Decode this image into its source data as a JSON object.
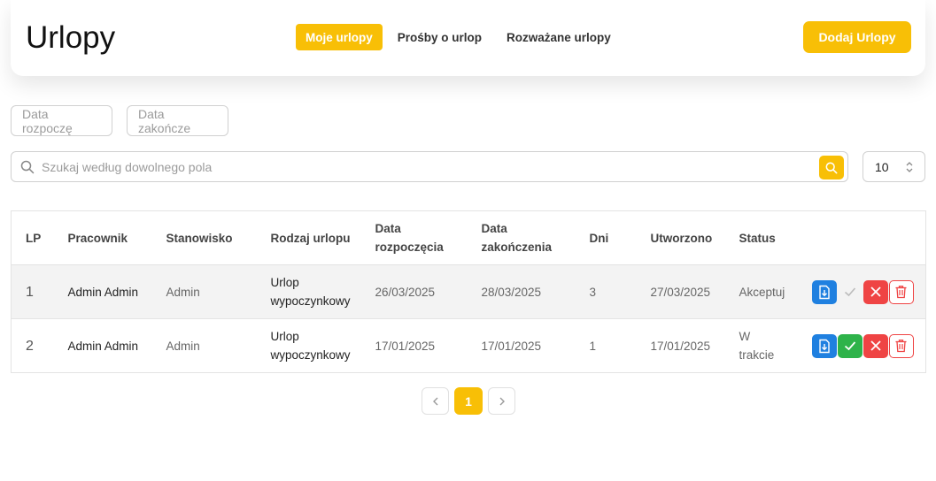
{
  "header": {
    "title": "Urlopy",
    "tabs": [
      {
        "label": "Moje urlopy",
        "active": true
      },
      {
        "label": "Prośby o urlop",
        "active": false
      },
      {
        "label": "Rozważane urlopy",
        "active": false
      }
    ],
    "add_button": "Dodaj Urlopy"
  },
  "filters": {
    "date_start_placeholder": "Data rozpoczę",
    "date_end_placeholder": "Data zakończe",
    "search_placeholder": "Szukaj według dowolnego pola",
    "page_size": "10"
  },
  "table": {
    "columns": [
      "LP",
      "Pracownik",
      "Stanowisko",
      "Rodzaj urlopu",
      "Data rozpoczęcia",
      "Data zakończenia",
      "Dni",
      "Utworzono",
      "Status"
    ],
    "rows": [
      {
        "lp": "1",
        "employee": "Admin Admin",
        "position": "Admin",
        "type": "Urlop wypoczynkowy",
        "start": "26/03/2025",
        "end": "28/03/2025",
        "days": "3",
        "created": "27/03/2025",
        "status": "Akceptuj"
      },
      {
        "lp": "2",
        "employee": "Admin Admin",
        "position": "Admin",
        "type": "Urlop wypoczynkowy",
        "start": "17/01/2025",
        "end": "17/01/2025",
        "days": "1",
        "created": "17/01/2025",
        "status": "W trakcie"
      }
    ]
  },
  "pagination": {
    "current": "1"
  },
  "colors": {
    "accent": "#f8bf06",
    "download": "#1f80e0",
    "approve": "#2eb34a",
    "reject": "#ef4444"
  },
  "icons": [
    "search-icon",
    "chevron-updown-icon",
    "file-download-icon",
    "check-icon",
    "close-icon",
    "trash-icon",
    "chevron-left-icon",
    "chevron-right-icon"
  ]
}
